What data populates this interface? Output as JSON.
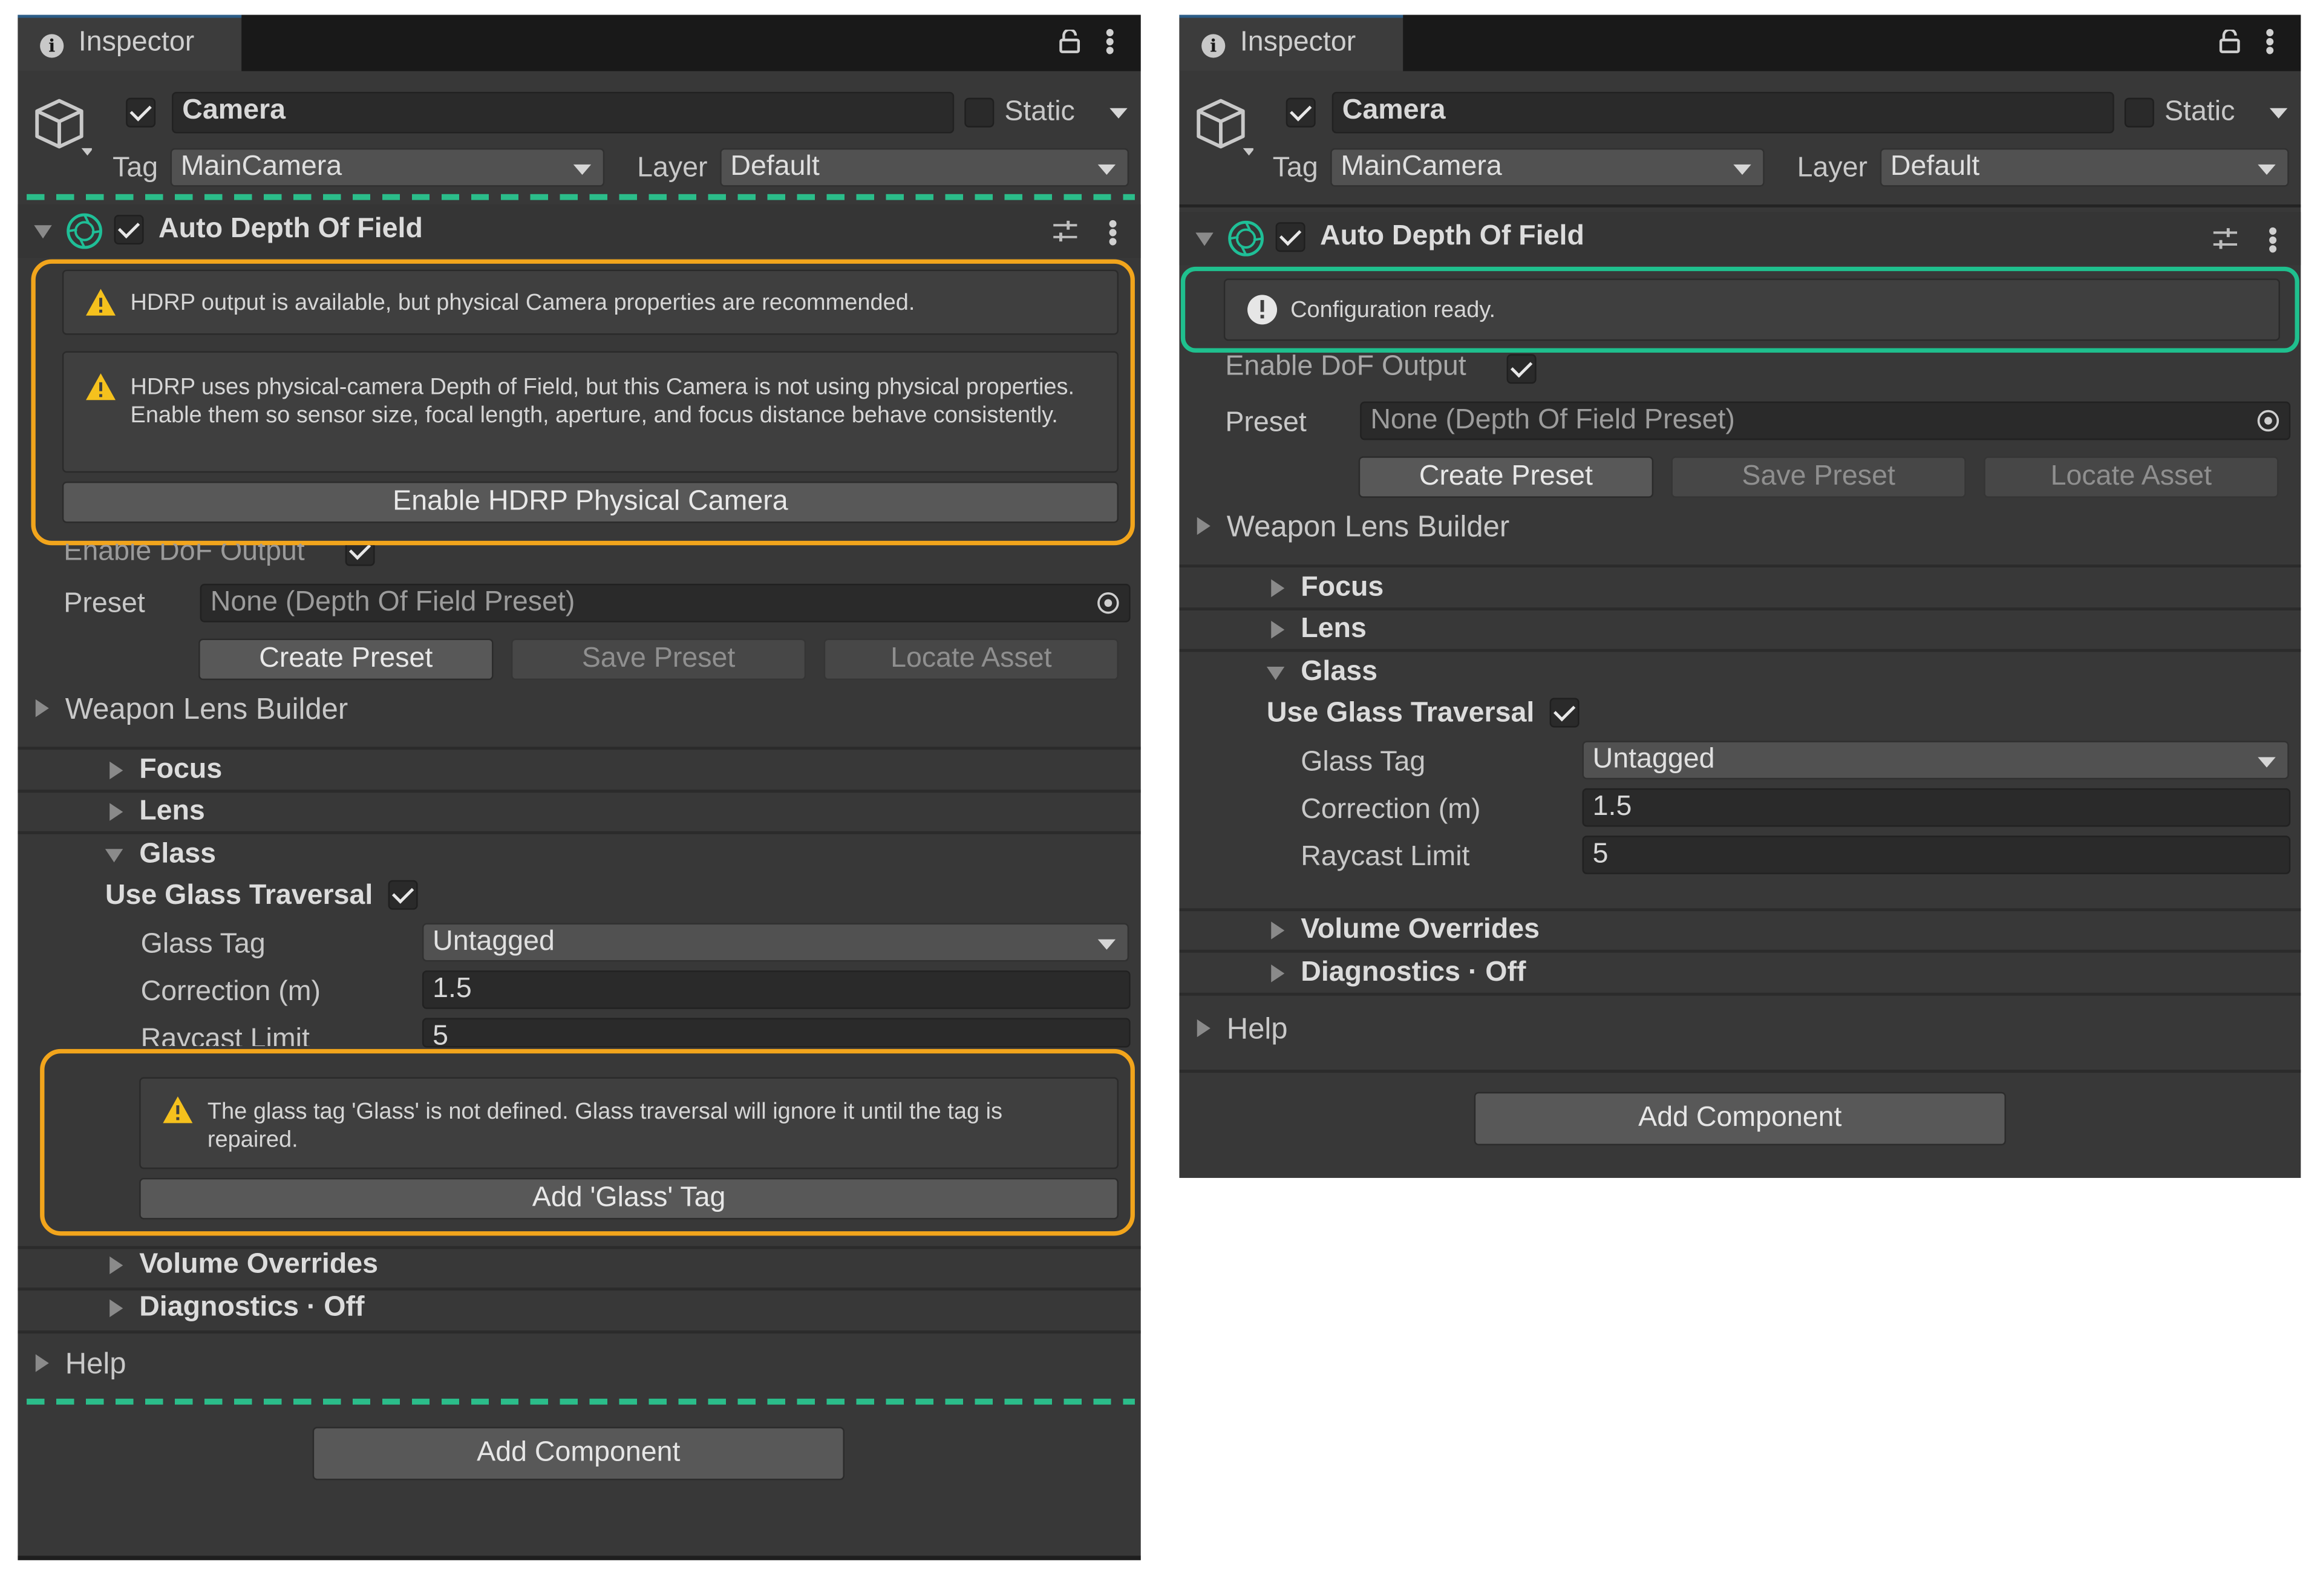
{
  "left": {
    "tab": {
      "label": "Inspector"
    },
    "header": {
      "name": "Camera",
      "static_label": "Static",
      "tag_label": "Tag",
      "tag_value": "MainCamera",
      "layer_label": "Layer",
      "layer_value": "Default"
    },
    "component": {
      "title": "Auto Depth Of Field"
    },
    "alert1": {
      "text": "HDRP output is available, but physical Camera properties are recommended."
    },
    "alert2": {
      "text": "HDRP uses physical-camera Depth of Field, but this Camera is not using physical properties. Enable them so sensor size, focal length, aperture, and focus distance behave consistently."
    },
    "enable_button": "Enable HDRP Physical Camera",
    "dof_output_label": "Enable DoF Output",
    "preset": {
      "label": "Preset",
      "value": "None (Depth Of Field Preset)"
    },
    "buttons": {
      "create": "Create Preset",
      "save": "Save Preset",
      "locate": "Locate Asset"
    },
    "weapon_lens_builder": "Weapon Lens Builder",
    "focus": "Focus",
    "lens": "Lens",
    "glass": "Glass",
    "use_glass_traversal": "Use Glass Traversal",
    "glass_tag": {
      "label": "Glass Tag",
      "value": "Untagged"
    },
    "correction": {
      "label": "Correction (m)",
      "value": "1.5"
    },
    "raycast": {
      "label": "Raycast Limit",
      "value": "5"
    },
    "glass_alert": {
      "text": "The glass tag 'Glass' is not defined. Glass traversal will ignore it until the tag is repaired."
    },
    "add_glass_tag": "Add 'Glass' Tag",
    "volume_overrides": "Volume Overrides",
    "diagnostics": "Diagnostics · Off",
    "help": "Help",
    "add_component": "Add Component"
  },
  "right": {
    "tab": {
      "label": "Inspector"
    },
    "header": {
      "name": "Camera",
      "static_label": "Static",
      "tag_label": "Tag",
      "tag_value": "MainCamera",
      "layer_label": "Layer",
      "layer_value": "Default"
    },
    "component": {
      "title": "Auto Depth Of Field"
    },
    "status": {
      "text": "Configuration ready."
    },
    "dof_output_label": "Enable DoF Output",
    "preset": {
      "label": "Preset",
      "value": "None (Depth Of Field Preset)"
    },
    "buttons": {
      "create": "Create Preset",
      "save": "Save Preset",
      "locate": "Locate Asset"
    },
    "weapon_lens_builder": "Weapon Lens Builder",
    "focus": "Focus",
    "lens": "Lens",
    "glass": "Glass",
    "use_glass_traversal": "Use Glass Traversal",
    "glass_tag": {
      "label": "Glass Tag",
      "value": "Untagged"
    },
    "correction": {
      "label": "Correction (m)",
      "value": "1.5"
    },
    "raycast": {
      "label": "Raycast Limit",
      "value": "5"
    },
    "volume_overrides": "Volume Overrides",
    "diagnostics": "Diagnostics · Off",
    "help": "Help",
    "add_component": "Add Component"
  },
  "colors": {
    "panel_bg": "#383838",
    "warning_highlight": "#f2a51c",
    "ok_highlight": "#1fc08e",
    "dashed_marker": "#2bbd8a",
    "warning_icon": "#f5c11d"
  },
  "icons": [
    "info-icon",
    "lock-icon",
    "more-menu-icon",
    "gameobject-cube-icon",
    "component-lens-icon",
    "preset-sliders-icon",
    "warning-icon",
    "info-exclamation-icon",
    "object-picker-icon",
    "foldout-arrow-icon"
  ]
}
